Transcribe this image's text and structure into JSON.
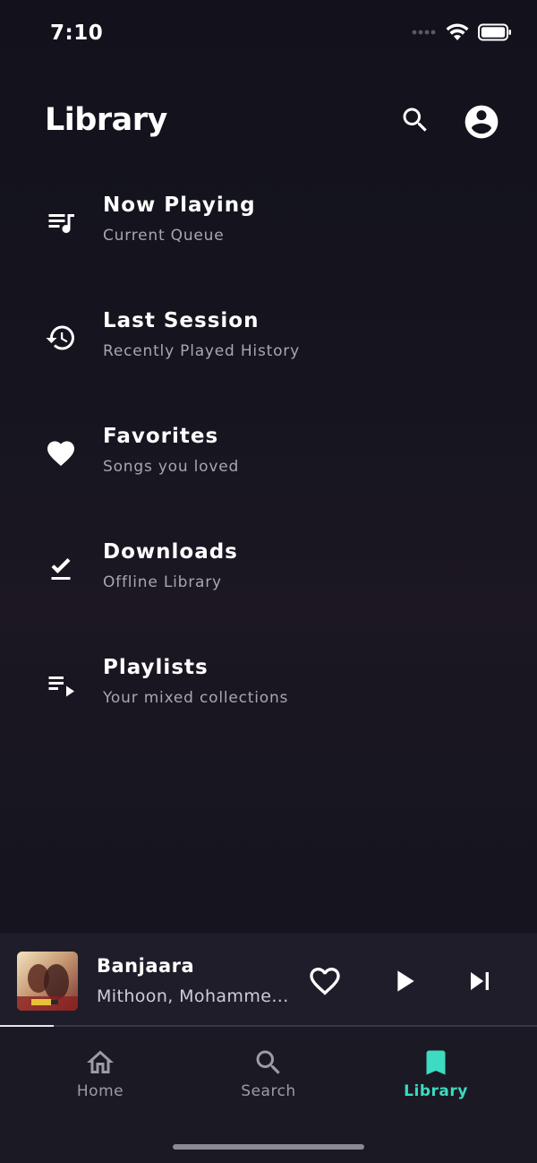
{
  "status_bar": {
    "time": "7:10"
  },
  "header": {
    "title": "Library",
    "search_icon": "search-icon",
    "account_icon": "account-circle-icon"
  },
  "menu": [
    {
      "title": "Now Playing",
      "subtitle": "Current Queue",
      "icon": "queue-music-icon"
    },
    {
      "title": "Last Session",
      "subtitle": "Recently Played History",
      "icon": "history-icon"
    },
    {
      "title": "Favorites",
      "subtitle": "Songs you loved",
      "icon": "heart-icon"
    },
    {
      "title": "Downloads",
      "subtitle": "Offline Library",
      "icon": "download-done-icon"
    },
    {
      "title": "Playlists",
      "subtitle": "Your mixed collections",
      "icon": "playlist-play-icon"
    }
  ],
  "mini_player": {
    "title": "Banjaara",
    "artist": "Mithoon, Mohamme...",
    "progress": 0.1
  },
  "tabs": [
    {
      "label": "Home",
      "icon": "home-icon",
      "active": false
    },
    {
      "label": "Search",
      "icon": "search-icon",
      "active": false
    },
    {
      "label": "Library",
      "icon": "bookmark-icon",
      "active": true
    }
  ],
  "colors": {
    "accent": "#3ddbc1",
    "background": "#16151f",
    "mini_player_bg": "#1e1d29",
    "subtitle": "#a8a6b0",
    "inactive_tab": "#9d9ca6"
  }
}
